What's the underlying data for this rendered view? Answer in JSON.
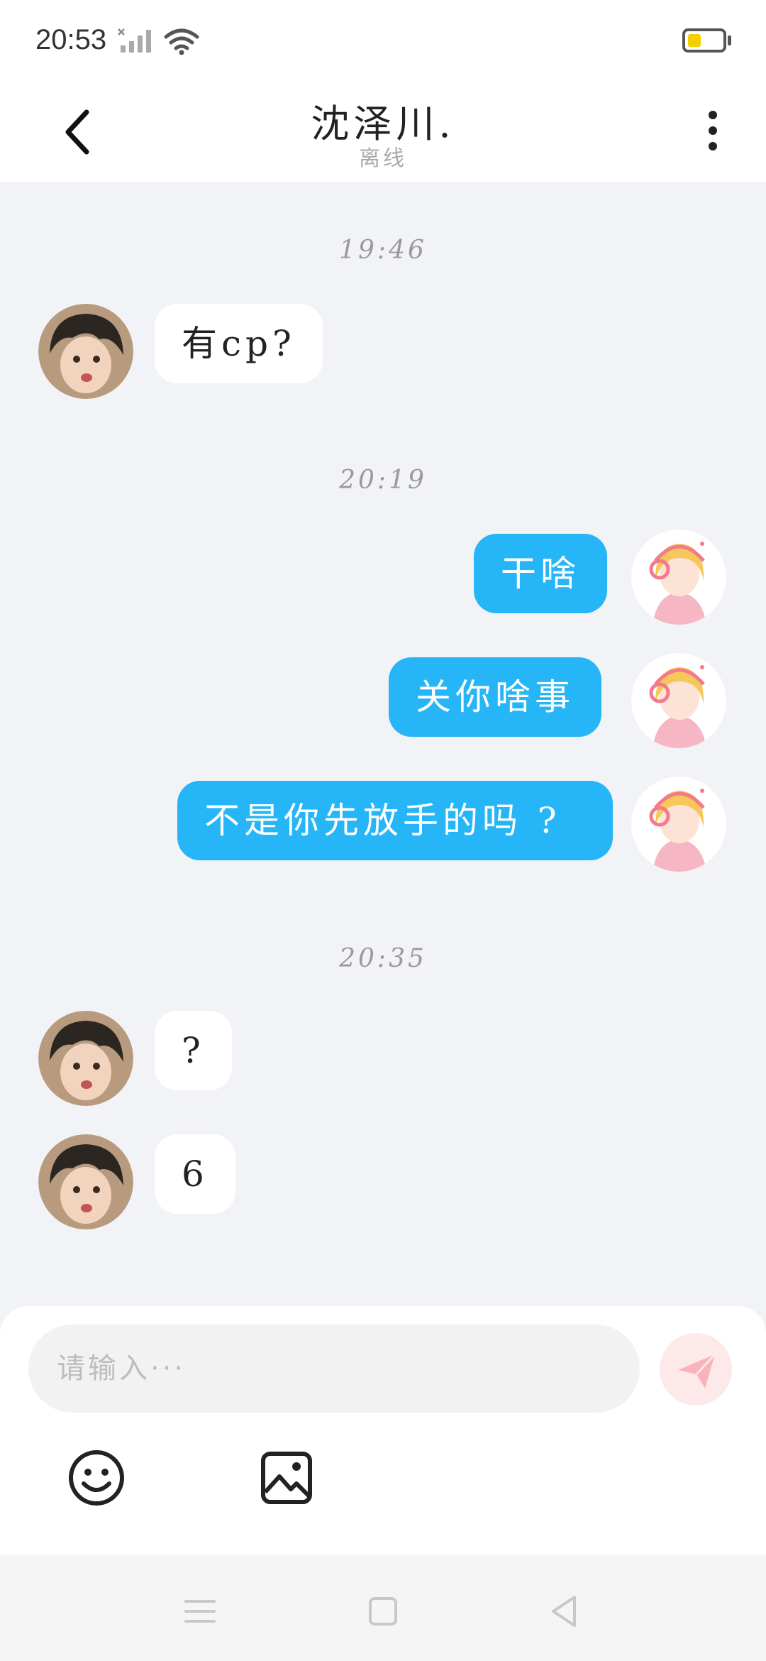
{
  "status_bar": {
    "time": "20:53",
    "signal_icon": "signal-no-service-icon",
    "wifi_icon": "wifi-icon",
    "battery_icon": "battery-low-icon",
    "battery_color": "#f4d000"
  },
  "header": {
    "title": "沈泽川.",
    "subtitle": "离线",
    "back_icon": "chevron-left-icon",
    "more_icon": "more-vertical-icon"
  },
  "chat": {
    "timestamps": [
      "19:46",
      "20:19",
      "20:35"
    ],
    "messages": [
      {
        "sender": "other",
        "text": "有cp?"
      },
      {
        "sender": "me",
        "text": "干啥"
      },
      {
        "sender": "me",
        "text": "关你啥事"
      },
      {
        "sender": "me",
        "text": "不是你先放手的吗 ?"
      },
      {
        "sender": "other",
        "text": "?"
      },
      {
        "sender": "other",
        "text": "6"
      }
    ],
    "outgoing_color": "#26b5f6",
    "incoming_color": "#ffffff"
  },
  "composer": {
    "placeholder": "请输入···",
    "send_icon": "paper-plane-icon",
    "emoji_icon": "smiley-icon",
    "image_icon": "image-icon"
  },
  "nav": {
    "menu_icon": "menu-icon",
    "home_icon": "square-home-icon",
    "back_icon": "triangle-back-icon"
  }
}
